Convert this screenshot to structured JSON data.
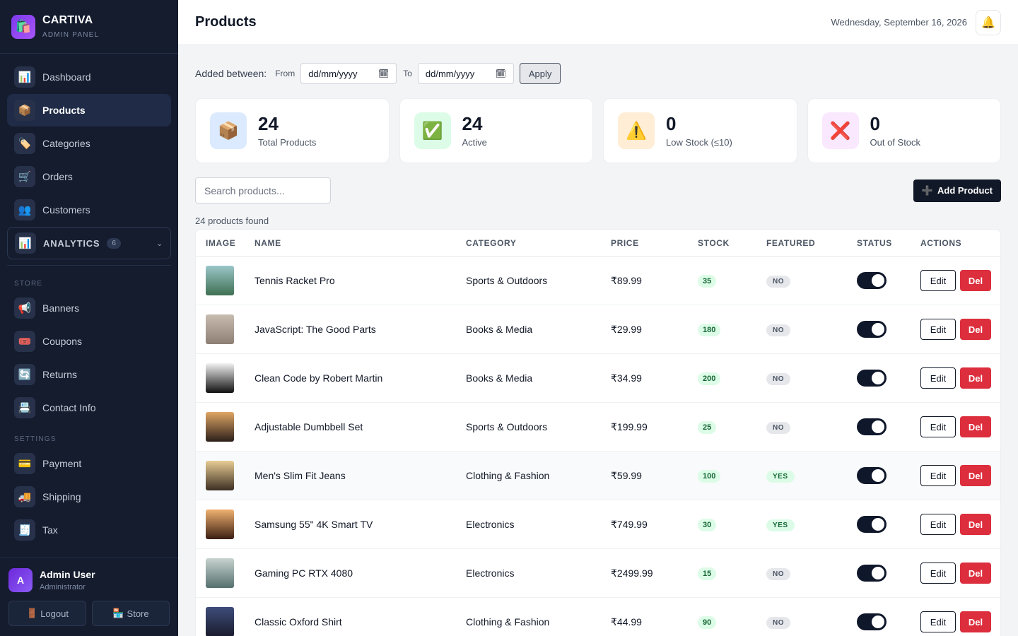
{
  "brand": {
    "name": "CARTIVA",
    "sub": "ADMIN PANEL",
    "logo_icon": "shopping-bags-icon"
  },
  "sidebar": {
    "main_items": [
      {
        "label": "Dashboard",
        "icon": "📊",
        "active": false
      },
      {
        "label": "Products",
        "icon": "📦",
        "active": true
      },
      {
        "label": "Categories",
        "icon": "🏷️",
        "active": false
      },
      {
        "label": "Orders",
        "icon": "🛒",
        "active": false
      },
      {
        "label": "Customers",
        "icon": "👥",
        "active": false
      }
    ],
    "analytics": {
      "label": "ANALYTICS",
      "count": "6",
      "icon": "📊"
    },
    "store_label": "STORE",
    "store_items": [
      {
        "label": "Banners",
        "icon": "📢"
      },
      {
        "label": "Coupons",
        "icon": "🎟️"
      },
      {
        "label": "Returns",
        "icon": "🔄"
      },
      {
        "label": "Contact Info",
        "icon": "📇"
      }
    ],
    "settings_label": "SETTINGS",
    "settings_items": [
      {
        "label": "Payment",
        "icon": "💳"
      },
      {
        "label": "Shipping",
        "icon": "🚚"
      },
      {
        "label": "Tax",
        "icon": "🧾"
      }
    ],
    "user": {
      "initial": "A",
      "name": "Admin User",
      "role": "Administrator",
      "logout": "Logout",
      "store": "Store"
    }
  },
  "header": {
    "title": "Products",
    "date": "Wednesday, September 16, 2026"
  },
  "filter": {
    "label": "Added between:",
    "from": "From",
    "to": "To",
    "from_value": "dd/mm/yyyy",
    "to_value": "dd/mm/yyyy",
    "apply": "Apply"
  },
  "stats": [
    {
      "value": "24",
      "label": "Total Products",
      "icon": "📦",
      "bg": "#dbeafe"
    },
    {
      "value": "24",
      "label": "Active",
      "icon": "✅",
      "bg": "#dcfce7"
    },
    {
      "value": "0",
      "label": "Low Stock (≤10)",
      "icon": "⚠️",
      "bg": "#ffedd5"
    },
    {
      "value": "0",
      "label": "Out of Stock",
      "icon": "❌",
      "bg": "#fae8ff"
    }
  ],
  "search": {
    "placeholder": "Search products..."
  },
  "add_button": "Add Product",
  "found_text": "24 products found",
  "table": {
    "columns": [
      "IMAGE",
      "NAME",
      "CATEGORY",
      "PRICE",
      "STOCK",
      "FEATURED",
      "STATUS",
      "ACTIONS"
    ],
    "edit_label": "Edit",
    "del_label": "Del",
    "rows": [
      {
        "name": "Tennis Racket Pro",
        "category": "Sports & Outdoors",
        "price": "₹89.99",
        "stock": "35",
        "featured": "NO",
        "thumb": [
          "#9cc6c9",
          "#3f7052"
        ]
      },
      {
        "name": "JavaScript: The Good Parts",
        "category": "Books & Media",
        "price": "₹29.99",
        "stock": "180",
        "featured": "NO",
        "thumb": [
          "#c9bcb0",
          "#8d7f74"
        ]
      },
      {
        "name": "Clean Code by Robert Martin",
        "category": "Books & Media",
        "price": "₹34.99",
        "stock": "200",
        "featured": "NO",
        "thumb": [
          "#f2f2f2",
          "#111111"
        ]
      },
      {
        "name": "Adjustable Dumbbell Set",
        "category": "Sports & Outdoors",
        "price": "₹199.99",
        "stock": "25",
        "featured": "NO",
        "thumb": [
          "#e0a664",
          "#2b1f1a"
        ]
      },
      {
        "name": "Men's Slim Fit Jeans",
        "category": "Clothing & Fashion",
        "price": "₹59.99",
        "stock": "100",
        "featured": "YES",
        "thumb": [
          "#e9cd94",
          "#3b2e22"
        ]
      },
      {
        "name": "Samsung 55\" 4K Smart TV",
        "category": "Electronics",
        "price": "₹749.99",
        "stock": "30",
        "featured": "YES",
        "thumb": [
          "#f0b270",
          "#3a1d12"
        ]
      },
      {
        "name": "Gaming PC RTX 4080",
        "category": "Electronics",
        "price": "₹2499.99",
        "stock": "15",
        "featured": "NO",
        "thumb": [
          "#c7d3cf",
          "#55706f"
        ]
      },
      {
        "name": "Classic Oxford Shirt",
        "category": "Clothing & Fashion",
        "price": "₹44.99",
        "stock": "90",
        "featured": "NO",
        "thumb": [
          "#3e4d7a",
          "#1a1c2d"
        ]
      }
    ]
  }
}
